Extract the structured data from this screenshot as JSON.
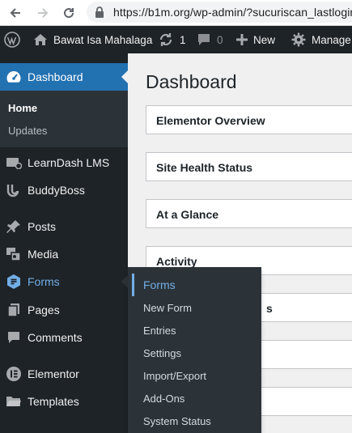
{
  "browser": {
    "url": "https://b1m.org/wp-admin/?sucuriscan_lastlogin"
  },
  "adminbar": {
    "site_name": "Bawat Isa Mahalaga",
    "updates_count": "1",
    "comments_count": "0",
    "new_label": "New",
    "manage_label": "Manage"
  },
  "sidebar": {
    "dashboard": "Dashboard",
    "home": "Home",
    "updates": "Updates",
    "items": [
      {
        "label": "LearnDash LMS",
        "icon": "learndash-icon"
      },
      {
        "label": "BuddyBoss",
        "icon": "buddyboss-icon"
      },
      {
        "label": "Posts",
        "icon": "pin-icon"
      },
      {
        "label": "Media",
        "icon": "media-icon"
      },
      {
        "label": "Forms",
        "icon": "forms-icon"
      },
      {
        "label": "Pages",
        "icon": "pages-icon"
      },
      {
        "label": "Comments",
        "icon": "comments-icon"
      },
      {
        "label": "Elementor",
        "icon": "elementor-icon"
      },
      {
        "label": "Templates",
        "icon": "folder-icon"
      }
    ]
  },
  "main": {
    "title": "Dashboard",
    "panels": [
      "Elementor Overview",
      "Site Health Status",
      "At a Glance",
      "Activity"
    ],
    "partial_text": "s"
  },
  "flyout": {
    "items": [
      "Forms",
      "New Form",
      "Entries",
      "Settings",
      "Import/Export",
      "Add-Ons",
      "System Status"
    ]
  },
  "colors": {
    "admin_dark": "#1d2327",
    "submenu_bg": "#2c3338",
    "accent_blue": "#2271b1",
    "hover_blue": "#72aee6"
  }
}
